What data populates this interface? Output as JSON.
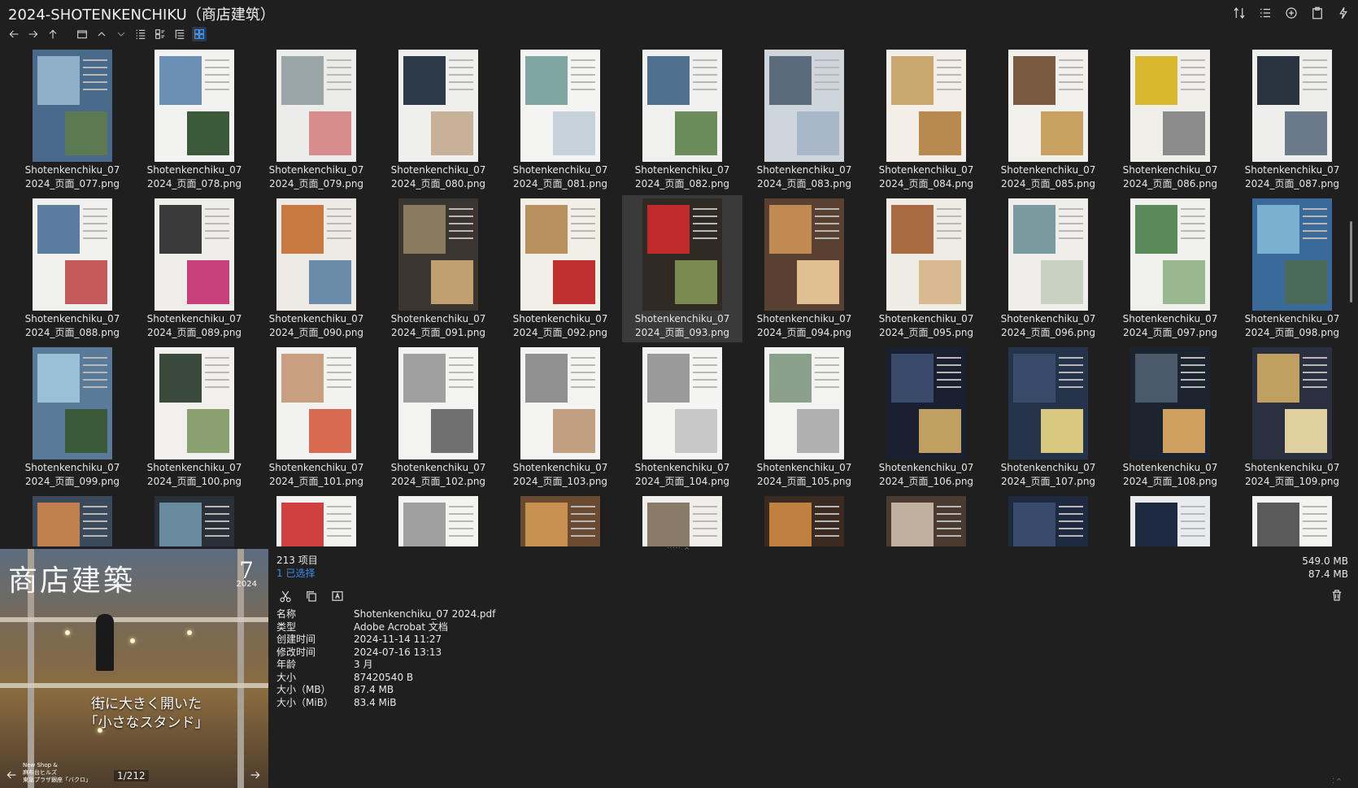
{
  "window": {
    "title": "2024-SHOTENKENCHIKU（商店建筑）"
  },
  "top_actions": [
    "sort-icon",
    "list-settings-icon",
    "add-icon",
    "clipboard-icon",
    "pin-icon"
  ],
  "toolbar": [
    "back-icon",
    "forward-icon",
    "up-icon",
    "folder-icon",
    "chevron-up-icon",
    "chevron-down-icon",
    "details-view-icon",
    "tiles-view-icon",
    "tree-view-icon",
    "thumbnail-view-icon"
  ],
  "files": [
    {
      "label": "Shotenkenchiku_07\n2024_页面_077.png"
    },
    {
      "label": "Shotenkenchiku_07\n2024_页面_078.png"
    },
    {
      "label": "Shotenkenchiku_07\n2024_页面_079.png"
    },
    {
      "label": "Shotenkenchiku_07\n2024_页面_080.png"
    },
    {
      "label": "Shotenkenchiku_07\n2024_页面_081.png"
    },
    {
      "label": "Shotenkenchiku_07\n2024_页面_082.png"
    },
    {
      "label": "Shotenkenchiku_07\n2024_页面_083.png"
    },
    {
      "label": "Shotenkenchiku_07\n2024_页面_084.png"
    },
    {
      "label": "Shotenkenchiku_07\n2024_页面_085.png"
    },
    {
      "label": "Shotenkenchiku_07\n2024_页面_086.png"
    },
    {
      "label": "Shotenkenchiku_07\n2024_页面_087.png"
    },
    {
      "label": "Shotenkenchiku_07\n2024_页面_088.png"
    },
    {
      "label": "Shotenkenchiku_07\n2024_页面_089.png"
    },
    {
      "label": "Shotenkenchiku_07\n2024_页面_090.png"
    },
    {
      "label": "Shotenkenchiku_07\n2024_页面_091.png"
    },
    {
      "label": "Shotenkenchiku_07\n2024_页面_092.png"
    },
    {
      "label": "Shotenkenchiku_07\n2024_页面_093.png"
    },
    {
      "label": "Shotenkenchiku_07\n2024_页面_094.png"
    },
    {
      "label": "Shotenkenchiku_07\n2024_页面_095.png"
    },
    {
      "label": "Shotenkenchiku_07\n2024_页面_096.png"
    },
    {
      "label": "Shotenkenchiku_07\n2024_页面_097.png"
    },
    {
      "label": "Shotenkenchiku_07\n2024_页面_098.png"
    },
    {
      "label": "Shotenkenchiku_07\n2024_页面_099.png"
    },
    {
      "label": "Shotenkenchiku_07\n2024_页面_100.png"
    },
    {
      "label": "Shotenkenchiku_07\n2024_页面_101.png"
    },
    {
      "label": "Shotenkenchiku_07\n2024_页面_102.png"
    },
    {
      "label": "Shotenkenchiku_07\n2024_页面_103.png"
    },
    {
      "label": "Shotenkenchiku_07\n2024_页面_104.png"
    },
    {
      "label": "Shotenkenchiku_07\n2024_页面_105.png"
    },
    {
      "label": "Shotenkenchiku_07\n2024_页面_106.png"
    },
    {
      "label": "Shotenkenchiku_07\n2024_页面_107.png"
    },
    {
      "label": "Shotenkenchiku_07\n2024_页面_108.png"
    },
    {
      "label": "Shotenkenchiku_07\n2024_页面_109.png"
    },
    {
      "label": ""
    },
    {
      "label": ""
    },
    {
      "label": ""
    },
    {
      "label": ""
    },
    {
      "label": ""
    },
    {
      "label": ""
    },
    {
      "label": ""
    },
    {
      "label": ""
    },
    {
      "label": ""
    },
    {
      "label": ""
    },
    {
      "label": ""
    }
  ],
  "selected_file": "Shotenkenchiku_07\n2024_页面_093.png",
  "preview": {
    "magazine_title": "商店建築",
    "issue": "7",
    "year": "2024",
    "headline": "街に大きく開いた\n「小さなスタンド」",
    "caption": "New Shop &\n麻布台ヒルズ\n東急プラザ銀座「バクロ」",
    "page_indicator": "1/212"
  },
  "details": {
    "item_count": "213 项目",
    "selected_count": "1 已选择",
    "total_size": "549.0 MB",
    "selected_size": "87.4 MB",
    "actions": [
      "cut-icon",
      "copy-icon",
      "rename-icon"
    ],
    "properties": [
      {
        "key": "名称",
        "value": "Shotenkenchiku_07 2024.pdf"
      },
      {
        "key": "类型",
        "value": "Adobe Acrobat 文档"
      },
      {
        "key": "创建时间",
        "value": "2024-11-14  11:27"
      },
      {
        "key": "修改时间",
        "value": "2024-07-16  13:13"
      },
      {
        "key": "年龄",
        "value": "3 月"
      },
      {
        "key": "大小",
        "value": "87420540 B"
      },
      {
        "key": "大小（MB）",
        "value": "87.4 MB"
      },
      {
        "key": "大小（MiB）",
        "value": "83.4 MiB"
      }
    ]
  }
}
